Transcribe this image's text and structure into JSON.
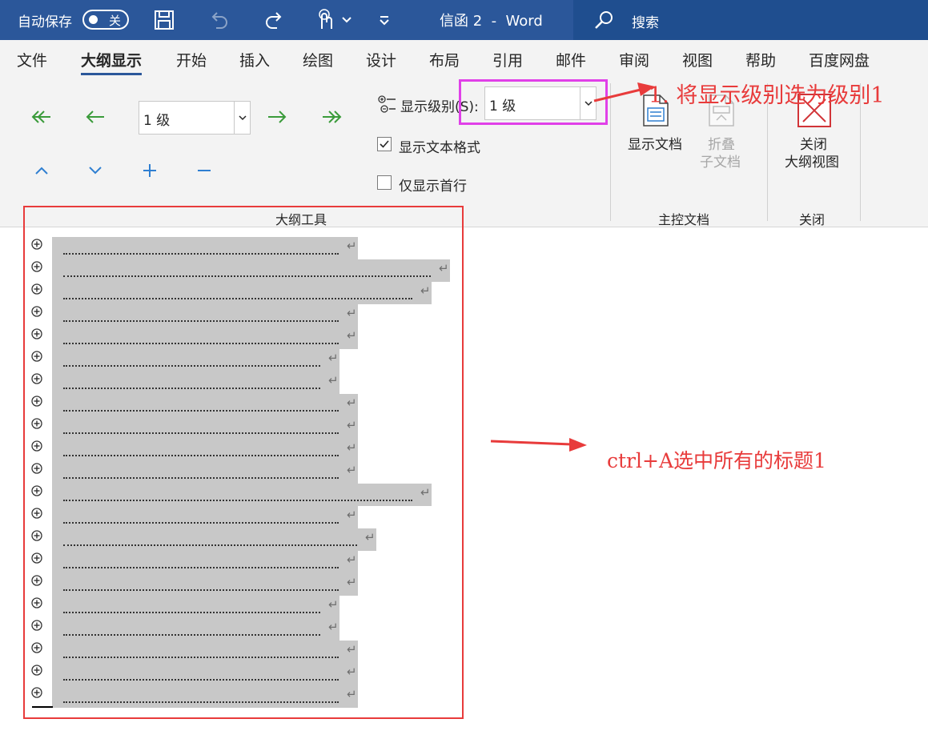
{
  "titlebar": {
    "autosave_label": "自动保存",
    "autosave_state": "关",
    "doc_title": "信函 2  -  Word",
    "search_label": "搜索",
    "colors": {
      "bar": "#2b579a",
      "search_box": "#1f4e8f"
    }
  },
  "tabs": [
    {
      "label": "文件"
    },
    {
      "label": "大纲显示",
      "active": true
    },
    {
      "label": "开始"
    },
    {
      "label": "插入"
    },
    {
      "label": "绘图"
    },
    {
      "label": "设计"
    },
    {
      "label": "布局"
    },
    {
      "label": "引用"
    },
    {
      "label": "邮件"
    },
    {
      "label": "审阅"
    },
    {
      "label": "视图"
    },
    {
      "label": "帮助"
    },
    {
      "label": "百度网盘"
    }
  ],
  "outline_tools": {
    "level_value": "1 级",
    "show_level_label": "显示级别(S):",
    "show_level_value": "1 级",
    "show_text_format_label": "显示文本格式",
    "show_text_format_checked": true,
    "first_line_only_label": "仅显示首行",
    "first_line_only_checked": false,
    "group_label": "大纲工具"
  },
  "master_document": {
    "show_document_label": "显示文档",
    "collapse_line1": "折叠",
    "collapse_line2": "子文档",
    "group_label": "主控文档"
  },
  "close_group": {
    "close_line1": "关闭",
    "close_line2": "大纲视图",
    "group_label": "关闭"
  },
  "outline": {
    "heading_count": 21,
    "paragraph_mark": "↵"
  },
  "annotations": {
    "note_1": "1. 将显示级别选为级别1",
    "note_2": "ctrl+A选中所有的标题1",
    "color_red": "#e83b3b",
    "color_magenta": "#e040e8"
  }
}
